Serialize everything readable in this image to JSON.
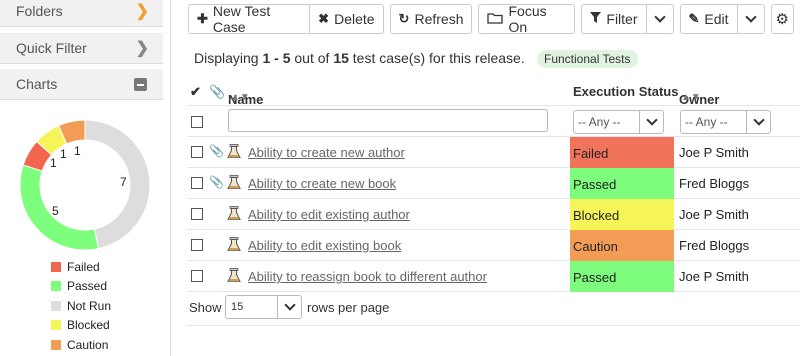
{
  "sidebar": {
    "folders": "Folders",
    "quick_filter": "Quick Filter",
    "charts": "Charts",
    "donut_labels": [
      "1",
      "1",
      "1",
      "5",
      "7"
    ],
    "legend": [
      {
        "label": "Failed",
        "color": "#f2664f"
      },
      {
        "label": "Passed",
        "color": "#7dff7d"
      },
      {
        "label": "Not Run",
        "color": "#dddddd"
      },
      {
        "label": "Blocked",
        "color": "#f5f55a"
      },
      {
        "label": "Caution",
        "color": "#f39c56"
      }
    ]
  },
  "chart_data": {
    "type": "pie",
    "categories": [
      "Failed",
      "Passed",
      "Not Run",
      "Blocked",
      "Caution"
    ],
    "values": [
      1,
      5,
      7,
      1,
      1
    ],
    "colors": [
      "#f2664f",
      "#7dff7d",
      "#dddddd",
      "#f5f55a",
      "#f39c56"
    ],
    "donut": true,
    "legend_placement": "bottom"
  },
  "toolbar": {
    "new_test_case": "New Test Case",
    "delete": "Delete",
    "refresh": "Refresh",
    "focus_on": "Focus On",
    "filter": "Filter",
    "edit": "Edit"
  },
  "summary": {
    "prefix": "Displaying",
    "range": "1 - 5",
    "mid": "out of",
    "total": "15",
    "suffix": "test case(s) for this release.",
    "badge": "Functional Tests"
  },
  "grid": {
    "headers": {
      "name": "Name",
      "status": "Execution Status",
      "owner": "Owner"
    },
    "filters": {
      "name_value": "",
      "status_value": "-- Any --",
      "owner_value": "-- Any --"
    },
    "rows": [
      {
        "name": "Ability to create new author",
        "status": "Failed",
        "status_color": "#f2735b",
        "owner": "Joe P Smith",
        "attachment": true
      },
      {
        "name": "Ability to create new book",
        "status": "Passed",
        "status_color": "#7dfc7d",
        "owner": "Fred Bloggs",
        "attachment": true
      },
      {
        "name": "Ability to edit existing author",
        "status": "Blocked",
        "status_color": "#f5f559",
        "owner": "Joe P Smith",
        "attachment": false
      },
      {
        "name": "Ability to edit existing book",
        "status": "Caution",
        "status_color": "#f39c56",
        "owner": "Fred Bloggs",
        "attachment": false
      },
      {
        "name": "Ability to reassign book to different author",
        "status": "Passed",
        "status_color": "#7dfc7d",
        "owner": "Joe P Smith",
        "attachment": false
      }
    ]
  },
  "pager": {
    "show": "Show",
    "rows_value": "15",
    "rows_per_page": "rows per page"
  }
}
